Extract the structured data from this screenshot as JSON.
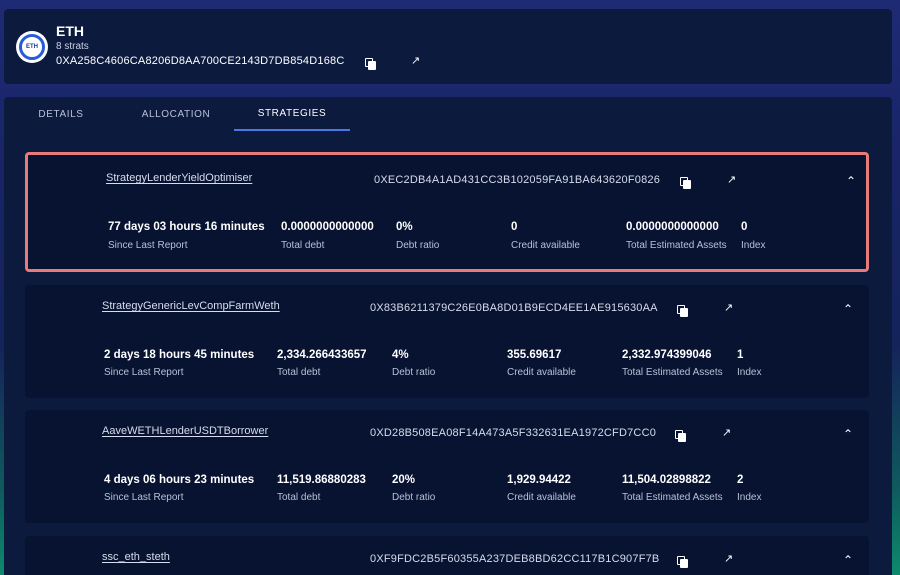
{
  "vault": {
    "name": "ETH",
    "strats": "8 strats",
    "address": "0XA258C4606CA8206D8AA700CE2143D7DB854D168C",
    "logo_text": "ETH"
  },
  "tabs": [
    {
      "label": "DETAILS",
      "active": false
    },
    {
      "label": "ALLOCATION",
      "active": false
    },
    {
      "label": "STRATEGIES",
      "active": true
    }
  ],
  "strategies": [
    {
      "name": "StrategyLenderYieldOptimiser",
      "address": "0XEC2DB4A1AD431CC3B102059FA91BA643620F0826",
      "metrics": [
        {
          "value": "77 days 03 hours 16 minutes",
          "label": "Since Last Report"
        },
        {
          "value": "0.0000000000000",
          "label": "Total debt"
        },
        {
          "value": "0%",
          "label": "Debt ratio"
        },
        {
          "value": "0",
          "label": "Credit available"
        },
        {
          "value": "0.0000000000000",
          "label": "Total Estimated Assets"
        },
        {
          "value": "0",
          "label": "Index"
        }
      ]
    },
    {
      "name": "StrategyGenericLevCompFarmWeth",
      "address": "0X83B6211379C26E0BA8D01B9ECD4EE1AE915630AA",
      "metrics": [
        {
          "value": "2 days 18 hours 45 minutes",
          "label": "Since Last Report"
        },
        {
          "value": "2,334.266433657",
          "label": "Total debt"
        },
        {
          "value": "4%",
          "label": "Debt ratio"
        },
        {
          "value": "355.69617",
          "label": "Credit available"
        },
        {
          "value": "2,332.974399046",
          "label": "Total Estimated Assets"
        },
        {
          "value": "1",
          "label": "Index"
        }
      ]
    },
    {
      "name": "AaveWETHLenderUSDTBorrower",
      "address": "0XD28B508EA08F14A473A5F332631EA1972CFD7CC0",
      "metrics": [
        {
          "value": "4 days 06 hours 23 minutes",
          "label": "Since Last Report"
        },
        {
          "value": "11,519.86880283",
          "label": "Total debt"
        },
        {
          "value": "20%",
          "label": "Debt ratio"
        },
        {
          "value": "1,929.94422",
          "label": "Credit available"
        },
        {
          "value": "11,504.02898822",
          "label": "Total Estimated Assets"
        },
        {
          "value": "2",
          "label": "Index"
        }
      ]
    },
    {
      "name": "ssc_eth_steth",
      "address": "0XF9FDC2B5F60355A237DEB8BD62CC117B1C907F7B",
      "metrics": []
    }
  ],
  "icons": {
    "copy": "copy-icon",
    "external": "external-link-icon",
    "chevron": "chevron-up-icon"
  },
  "colors": {
    "highlight_border": "#e87a7a",
    "active_tab": "#4a78e8"
  }
}
